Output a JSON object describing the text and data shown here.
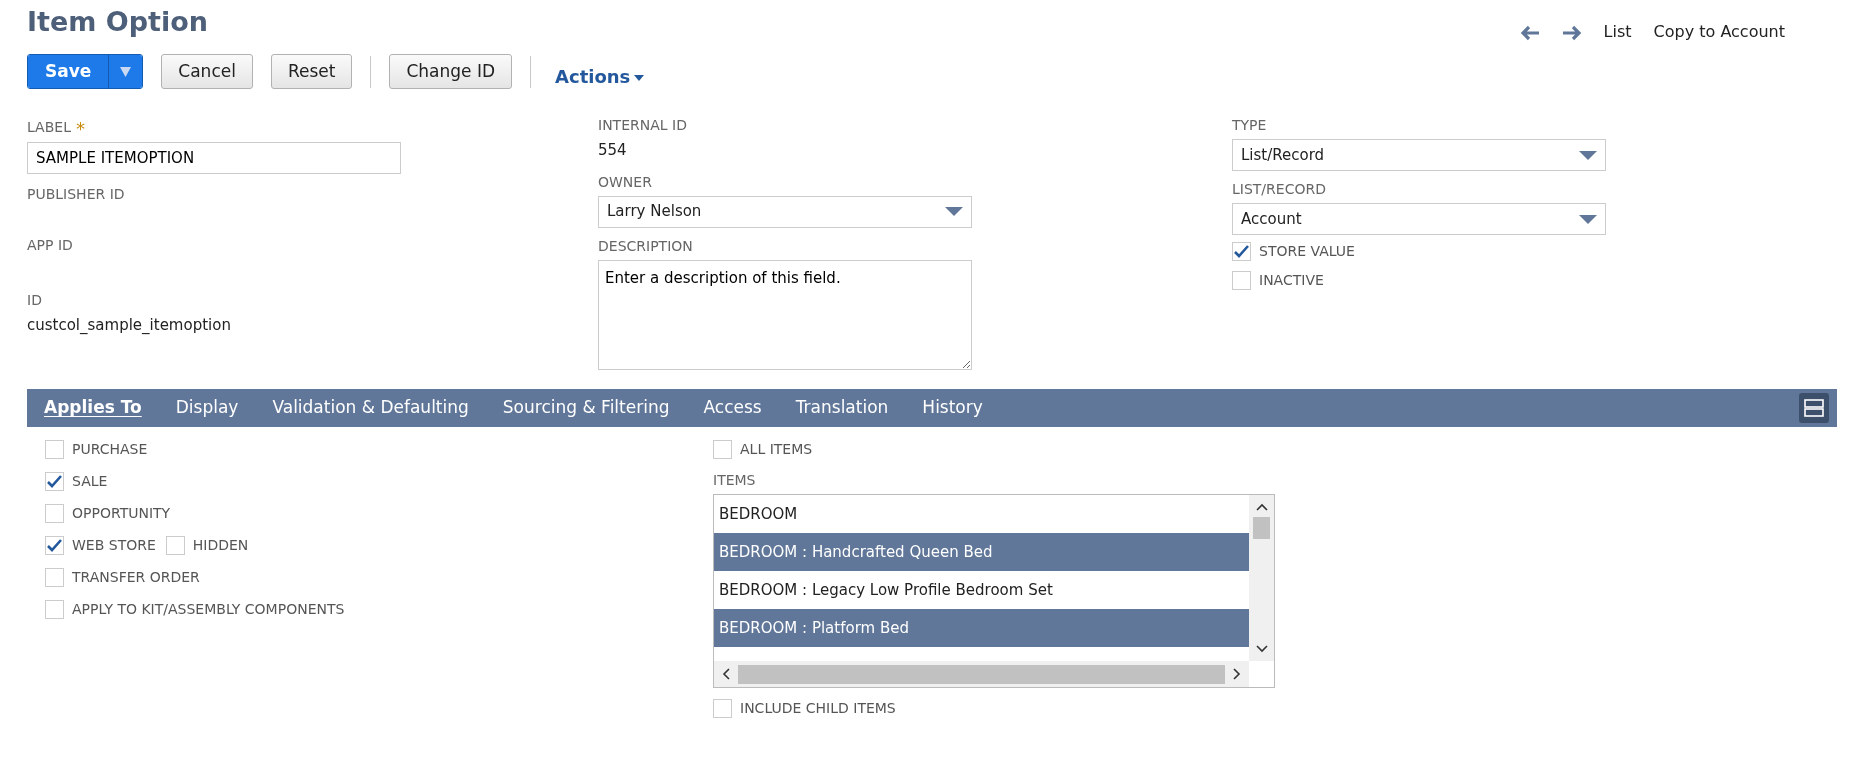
{
  "page_title": "Item Option",
  "nav": {
    "list_link": "List",
    "copy_link": "Copy to Account"
  },
  "toolbar": {
    "save": "Save",
    "buttons": [
      "Cancel",
      "Reset",
      "Change ID"
    ],
    "actions": "Actions"
  },
  "fields": {
    "label": {
      "label": "LABEL",
      "required_mark": "*",
      "value": "SAMPLE ITEMOPTION"
    },
    "publisher_id": {
      "label": "PUBLISHER ID"
    },
    "app_id": {
      "label": "APP ID"
    },
    "id": {
      "label": "ID",
      "value": "custcol_sample_itemoption"
    },
    "internal_id": {
      "label": "INTERNAL ID",
      "value": "554"
    },
    "owner": {
      "label": "OWNER",
      "value": "Larry Nelson"
    },
    "description": {
      "label": "DESCRIPTION",
      "value": "Enter a description of this field."
    },
    "type": {
      "label": "TYPE",
      "value": "List/Record"
    },
    "list_record": {
      "label": "LIST/RECORD",
      "value": "Account"
    },
    "flags": [
      {
        "label": "STORE VALUE",
        "checked": true
      },
      {
        "label": "INACTIVE",
        "checked": false
      }
    ]
  },
  "tabs": [
    {
      "label": "Applies To",
      "selected": true
    },
    {
      "label": "Display",
      "selected": false
    },
    {
      "label": "Validation & Defaulting",
      "selected": false
    },
    {
      "label": "Sourcing & Filtering",
      "selected": false
    },
    {
      "label": "Access",
      "selected": false
    },
    {
      "label": "Translation",
      "selected": false
    },
    {
      "label": "History",
      "selected": false
    }
  ],
  "applies_to": [
    [
      {
        "label": "PURCHASE",
        "checked": false
      }
    ],
    [
      {
        "label": "SALE",
        "checked": true
      }
    ],
    [
      {
        "label": "OPPORTUNITY",
        "checked": false
      }
    ],
    [
      {
        "label": "WEB STORE",
        "checked": true
      },
      {
        "label": "HIDDEN",
        "checked": false
      }
    ],
    [
      {
        "label": "TRANSFER ORDER",
        "checked": false
      }
    ],
    [
      {
        "label": "APPLY TO KIT/ASSEMBLY COMPONENTS",
        "checked": false
      }
    ]
  ],
  "all_items": {
    "label": "ALL ITEMS",
    "checked": false
  },
  "items": {
    "label": "ITEMS",
    "options": [
      {
        "text": "BEDROOM",
        "selected": false
      },
      {
        "text": "BEDROOM : Handcrafted Queen Bed",
        "selected": true
      },
      {
        "text": "BEDROOM : Legacy Low Profile Bedroom Set",
        "selected": false
      },
      {
        "text": "BEDROOM : Platform Bed",
        "selected": true
      }
    ]
  },
  "include_child": {
    "label": "INCLUDE CHILD ITEMS",
    "checked": false
  }
}
